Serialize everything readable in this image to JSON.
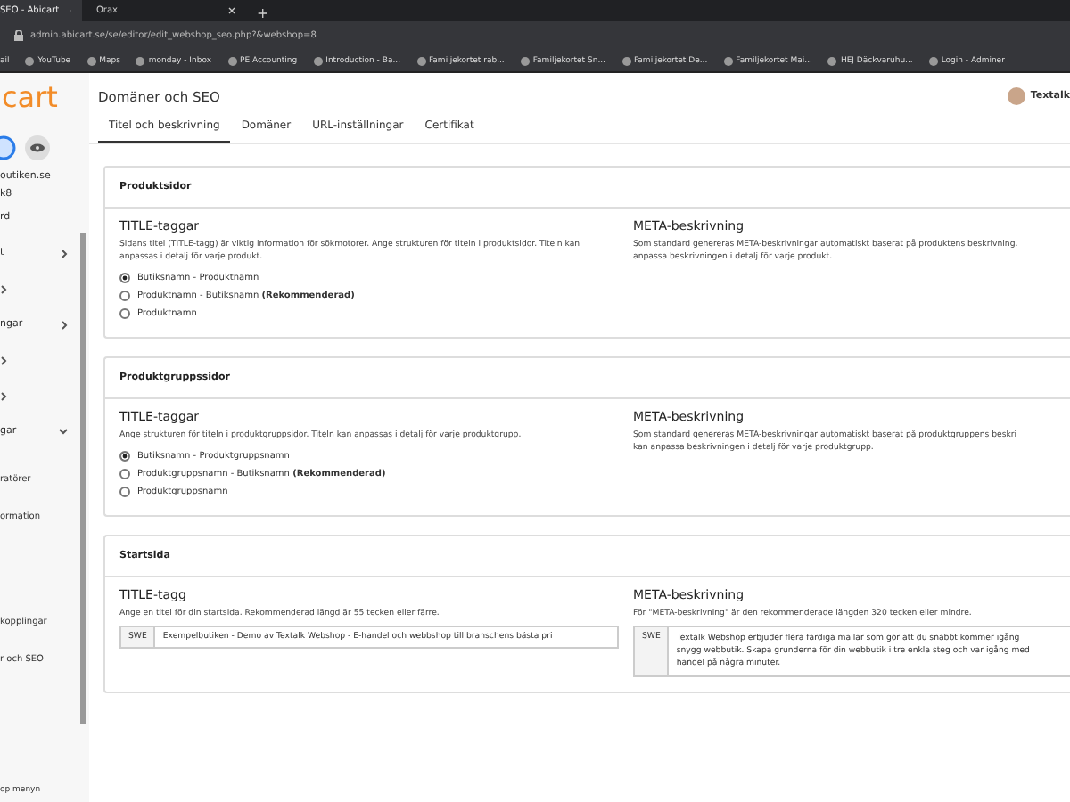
{
  "browser": {
    "tabs": [
      {
        "label": "SEO - Abicart",
        "selected": true
      },
      {
        "label": "Orax",
        "selected": false
      }
    ],
    "new_tab": "+",
    "address": "admin.abicart.se/se/editor/edit_webshop_seo.php?&webshop=8",
    "bookmarks": [
      "ail",
      "YouTube",
      "Maps",
      "monday - Inbox",
      "PE Accounting",
      "Introduction - Ba...",
      "Familjekortet rab...",
      "Familjekortet Sn...",
      "Familjekortet De...",
      "Familjekortet Mai...",
      "HEJ Däckvaruhu...",
      "Login - Adminer"
    ]
  },
  "sidebar": {
    "logo": "cart",
    "url": "outiken.se",
    "subtitle": "k8",
    "items": [
      {
        "label": "rd",
        "kind": "link"
      },
      {
        "label": "t",
        "kind": "group",
        "expanded": false
      },
      {
        "kind": "group",
        "expanded": false
      },
      {
        "label": "ngar",
        "kind": "group",
        "expanded": false
      },
      {
        "kind": "group",
        "expanded": false
      },
      {
        "kind": "group",
        "expanded": false
      },
      {
        "label": "gar",
        "kind": "group",
        "expanded": true
      }
    ],
    "subitems": [
      "ratörer",
      "ormation",
      "kopplingar",
      "r och SEO"
    ],
    "footer": "op menyn"
  },
  "header": {
    "title": "Domäner och SEO",
    "user": "Textalk",
    "tabs": [
      {
        "label": "Titel och beskrivning",
        "selected": true
      },
      {
        "label": "Domäner",
        "selected": false
      },
      {
        "label": "URL-inställningar",
        "selected": false
      },
      {
        "label": "Certifikat",
        "selected": false
      }
    ]
  },
  "sections": [
    {
      "kind": "radios",
      "title": "Produktsidor",
      "left": {
        "heading": "TITLE-taggar",
        "text": "Sidans titel (TITLE-tagg) är viktig information för sökmotorer. Ange strukturen för titeln i produktsidor. Titeln kan anpassas i detalj för varje produkt.",
        "options": [
          {
            "label": "Butiksnamn - Produktnamn",
            "selected": true
          },
          {
            "label": "Produktnamn - Butiksnamn **(Rekommenderad)**",
            "selected": false
          },
          {
            "label": "Produktnamn",
            "selected": false
          }
        ]
      },
      "right": {
        "heading": "META-beskrivning",
        "text": "Som standard genereras META-beskrivningar automatiskt baserat på produktens beskrivning.\nanpassa beskrivningen i detalj för varje produkt."
      }
    },
    {
      "kind": "radios",
      "title": "Produktgruppssidor",
      "left": {
        "heading": "TITLE-taggar",
        "text": "Ange strukturen för titeln i produktgruppsidor. Titeln kan anpassas i detalj för varje produktgrupp.",
        "options": [
          {
            "label": "Butiksnamn - Produktgruppsnamn",
            "selected": true
          },
          {
            "label": "Produktgruppsnamn - Butiksnamn **(Rekommenderad)**",
            "selected": false
          },
          {
            "label": "Produktgruppsnamn",
            "selected": false
          }
        ]
      },
      "right": {
        "heading": "META-beskrivning",
        "text": "Som standard genereras META-beskrivningar automatiskt baserat på produktgruppens beskri\nkan anpassa beskrivningen i detalj för varje produktgrupp."
      }
    },
    {
      "kind": "fields",
      "title": "Startsida",
      "left": {
        "heading": "TITLE-tagg",
        "text": "Ange en titel för din startsida. Rekommenderad längd är 55 tecken eller färre.",
        "field": {
          "prefix": "SWE",
          "value": "Exempelbutiken - Demo av Textalk Webshop - E-handel och webbshop till branschens bästa pri"
        }
      },
      "right": {
        "heading": "META-beskrivning",
        "text": "För \"META-beskrivning\" är den rekommenderade längden 320 tecken eller mindre.",
        "field": {
          "prefix": "SWE",
          "value": "Textalk Webshop erbjuder flera färdiga mallar som gör att du snabbt kommer igång\nsnygg webbutik. Skapa grunderna för din webbutik i tre enkla steg och var igång med\nhandel på några minuter."
        }
      }
    }
  ]
}
